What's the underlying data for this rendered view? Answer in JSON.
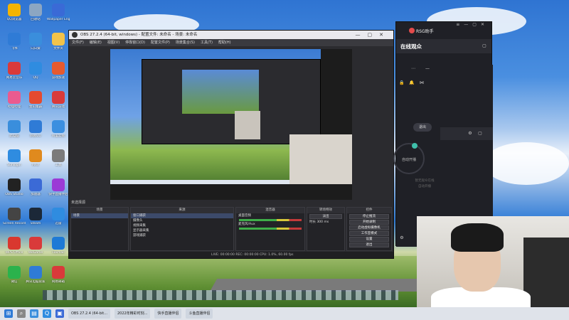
{
  "desktop": {
    "icons": [
      {
        "label": "QQ浏览器",
        "icon": "browser-icon",
        "color": "#f4b400"
      },
      {
        "label": "飞书",
        "icon": "feishu-icon",
        "color": "#2f7bd6"
      },
      {
        "label": "网易云音乐",
        "icon": "music-icon",
        "color": "#d93a3a"
      },
      {
        "label": "哔哩哔哩",
        "icon": "bilibili-icon",
        "color": "#ea5b8f"
      },
      {
        "label": "此电脑",
        "icon": "computer-icon",
        "color": "#3a8edc"
      },
      {
        "label": "Sunlogin",
        "icon": "sunlogin-icon",
        "color": "#2f8ce0"
      },
      {
        "label": "OBS Studio",
        "icon": "obs-icon",
        "color": "#222222"
      },
      {
        "label": "Screen Recorder",
        "icon": "recorder-icon",
        "color": "#444444"
      },
      {
        "label": "WPS Office",
        "icon": "wps-icon",
        "color": "#d9382f"
      },
      {
        "label": "微信",
        "icon": "wechat-icon",
        "color": "#2bb24c"
      },
      {
        "label": "回收站",
        "icon": "recycle-icon",
        "color": "#8ca6c2"
      },
      {
        "label": "向日葵",
        "icon": "sunflower-icon",
        "color": "#3a8edc"
      },
      {
        "label": "QQ",
        "icon": "qq-icon",
        "color": "#2f8ce0"
      },
      {
        "label": "金山毒霸",
        "icon": "antivirus-icon",
        "color": "#e54a2f"
      },
      {
        "label": "网易UU",
        "icon": "uu-icon",
        "color": "#2f7bd6"
      },
      {
        "label": "MAX",
        "icon": "max-icon",
        "color": "#e08a1e"
      },
      {
        "label": "加速器",
        "icon": "boost-icon",
        "color": "#3b6ad6"
      },
      {
        "label": "Steam",
        "icon": "steam-icon",
        "color": "#1b2838"
      },
      {
        "label": "WeGame",
        "icon": "wegame-icon",
        "color": "#d93a3a"
      },
      {
        "label": "腾讯电脑管家",
        "icon": "shield-icon",
        "color": "#2f7bd6"
      },
      {
        "label": "Wallpaper Engine",
        "icon": "wallpaper-icon",
        "color": "#3a6ad6"
      },
      {
        "label": "文件夹",
        "icon": "folder-icon",
        "color": "#f2c34a"
      },
      {
        "label": "游戏加速",
        "icon": "game-icon",
        "color": "#e55a2f"
      },
      {
        "label": "腾讯游戏",
        "icon": "tencent-game-icon",
        "color": "#d93a3a"
      },
      {
        "label": "阿里云盘",
        "icon": "cloud-drive-icon",
        "color": "#3b8fe0"
      },
      {
        "label": "工具",
        "icon": "tool-icon",
        "color": "#7b7b7b"
      },
      {
        "label": "快手直播伴侣",
        "icon": "kuaishou-icon",
        "color": "#9b3ad6"
      },
      {
        "label": "迅雷",
        "icon": "thunder-icon",
        "color": "#2f8ce0"
      },
      {
        "label": "Foxmail",
        "icon": "foxmail-icon",
        "color": "#1e7ad6"
      },
      {
        "label": "网易邮箱",
        "icon": "mail-icon",
        "color": "#d93a3a"
      }
    ]
  },
  "obs": {
    "title": "OBS 27.2.4 (64-bit, windows) - 配置文件: 未命名 - 场景: 未命名",
    "menu": [
      "文件(F)",
      "编辑(E)",
      "视图(V)",
      "停靠窗口(D)",
      "配置文件(P)",
      "场景集合(S)",
      "工具(T)",
      "帮助(H)"
    ],
    "status_bar_text": "未选择源",
    "panels": {
      "scenes": {
        "title": "场景",
        "items": [
          "场景"
        ]
      },
      "sources": {
        "title": "来源",
        "items": [
          "窗口捕获",
          "摄像头",
          "视频采集",
          "显示器采集",
          "游戏捕获"
        ]
      },
      "mixer": {
        "title": "混音器",
        "tracks": [
          "桌面音频",
          "麦克风/Aux"
        ]
      },
      "transitions": {
        "title": "转场特效",
        "type": "淡出",
        "duration_label": "时长",
        "duration_value": "300 ms"
      },
      "controls": {
        "title": "控件",
        "buttons": [
          "停止推流",
          "开始录制",
          "启动虚拟摄像机",
          "工作室模式",
          "设置",
          "退出"
        ]
      }
    },
    "status": "LIVE: 00:00:00   REC: 00:00:00   CPU: 1.0%, 60.00 fps"
  },
  "viewer": {
    "app_name": "RSG助手",
    "subtitle": "在线观众",
    "exit_label": "退出",
    "circle_label": "自动开播",
    "faint_text_1": "暂无观众在线",
    "faint_text_2": "自动开播"
  },
  "taskbar": {
    "items": [
      "OBS 27.2.4 (64-bit...",
      "2022年精彩时刻...",
      "快手直播伴侣",
      "斗鱼直播伴侣"
    ]
  },
  "colors": {
    "obs_bg": "#2b2b2f",
    "viewer_bg": "#1f2026",
    "accent_teal": "#3fbfaa",
    "taskbar_bg": "#dfe3ea"
  }
}
